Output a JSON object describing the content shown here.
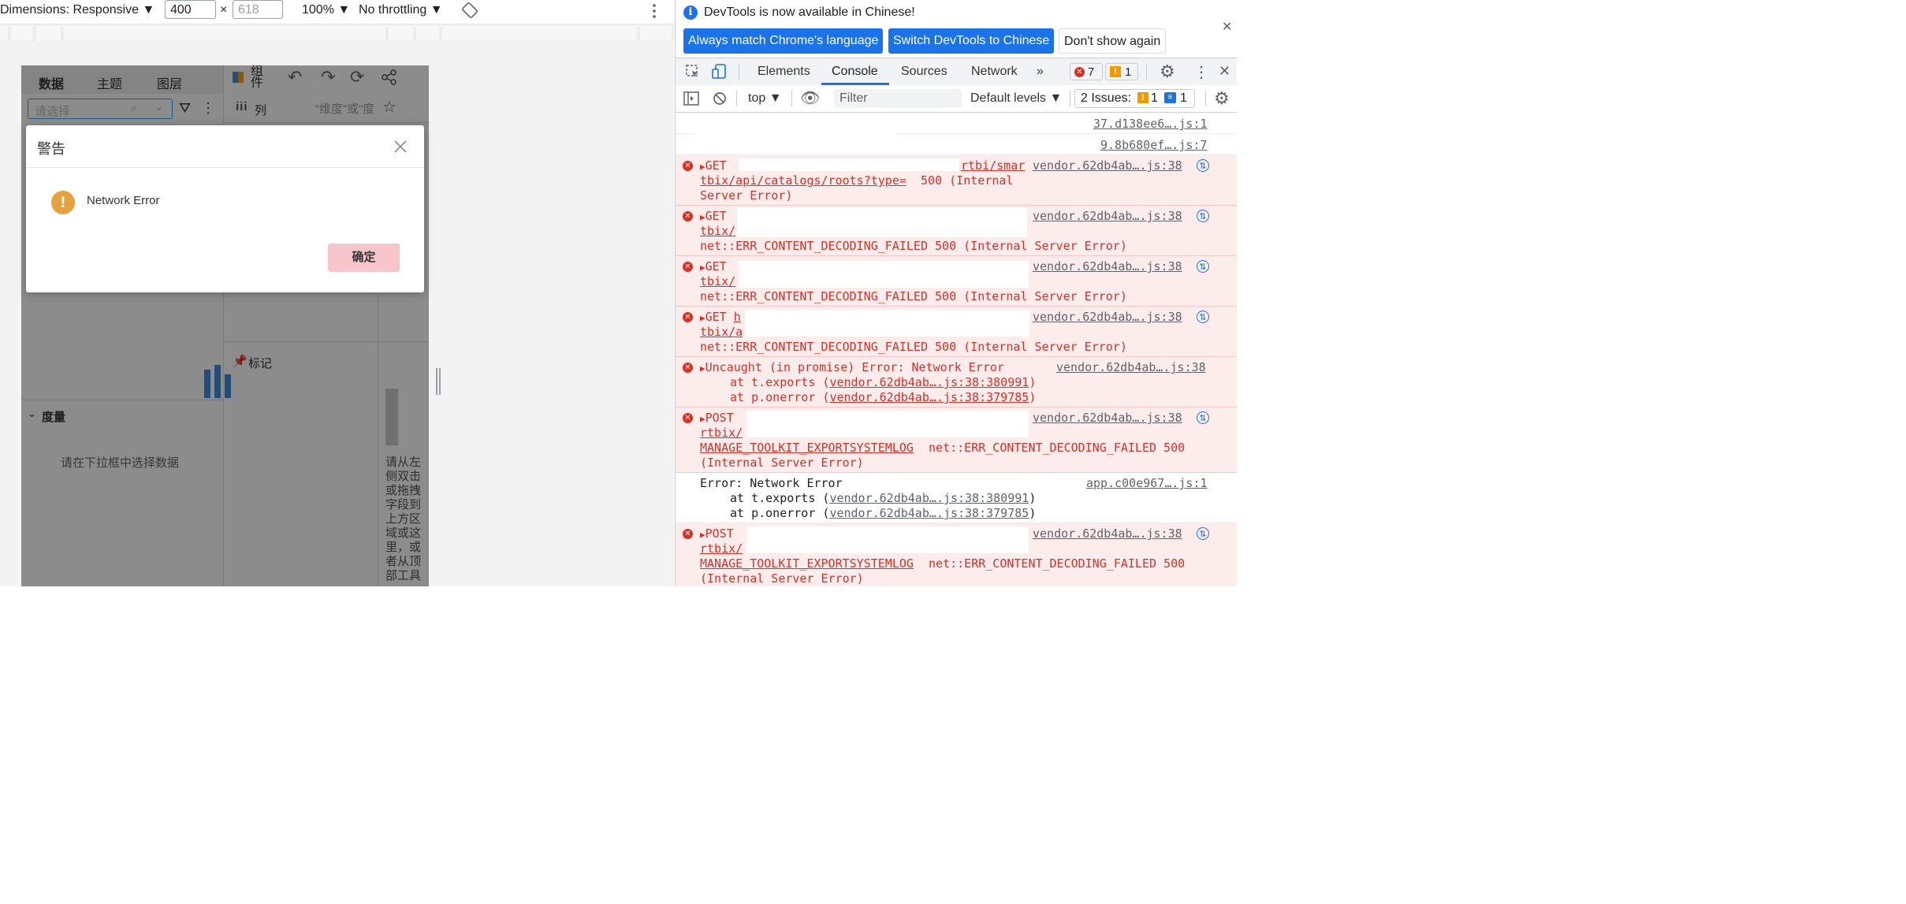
{
  "device_toolbar": {
    "dimensions": "Dimensions: Responsive ▼",
    "width": "400",
    "height_placeholder": "618",
    "times": "×",
    "zoom": "100% ▼",
    "throttle": "No throttling ▼"
  },
  "app": {
    "tabs": [
      "数据",
      "主题",
      "图层"
    ],
    "component_label": "组\n件",
    "select_placeholder": "请选择",
    "columns_label": "列",
    "dimension_hint": "“维度”或“度",
    "marks_label": "标记",
    "measure_label": "度量",
    "select_data_hint": "请在下拉框中选择数据",
    "drag_hint": "请从左\n侧双击\n或拖拽\n字段到\n上方区\n域或这\n里，或\n者从顶\n部工具"
  },
  "modal": {
    "title": "警告",
    "message": "Network Error",
    "ok_label": "确定",
    "warn_glyph": "!"
  },
  "devtools": {
    "info_text": "DevTools is now available in Chinese!",
    "btn_match": "Always match Chrome's language",
    "btn_switch": "Switch DevTools to Chinese",
    "btn_dont_show": "Don't show again",
    "tabs": [
      "Elements",
      "Console",
      "Sources",
      "Network",
      "»"
    ],
    "error_count": "7",
    "warn_count": "1",
    "context": "top ▼",
    "filter_placeholder": "Filter",
    "levels": "Default levels ▼",
    "issues_label": "2 Issues:",
    "issues_warn": "1",
    "issues_info": "1"
  },
  "console": {
    "src1": "37.d138ee6….js:1",
    "src2": "9.8b680ef….js:7",
    "vendor38": "vendor.62db4ab….js:38",
    "app1": "app.c00e967….js:1",
    "get": "GET",
    "post": "POST",
    "h": "h",
    "e1_url_a": "rtbi/smar",
    "e1_url_b": "tbix/api/catalogs/roots?type=",
    "e1_status": " 500 (Internal",
    "e1_status2": "Server Error)",
    "e2_url": "tbix/",
    "e3_url": "tbix/",
    "e4_url": "tbix/a",
    "decode_err": "net::ERR_CONTENT_DECODING_FAILED 500 (Internal Server Error)",
    "uncaught": "Uncaught (in promise) Error: Network Error",
    "at_exports": "at t.exports (",
    "at_onerror": "at p.onerror (",
    "trace1": "vendor.62db4ab….js:38:380991",
    "trace2": "vendor.62db4ab….js:38:379785",
    "close_paren": ")",
    "p_url": "rtbix/",
    "p_url_b": "MANAGE_TOOLKIT_EXPORTSYSTEMLOG",
    "p_err": " net::ERR_CONTENT_DECODING_FAILED 500",
    "p_err2": "(Internal Server Error)",
    "plain_err": "Error: Network Error"
  }
}
